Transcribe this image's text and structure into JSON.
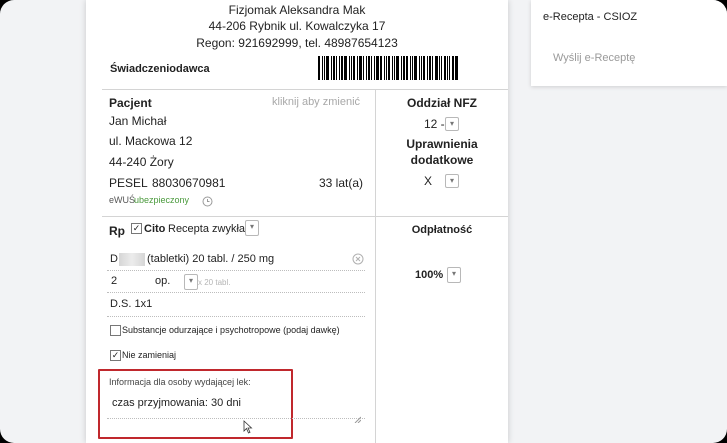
{
  "header": {
    "name": "Fizjomak Aleksandra Mak",
    "address": "44-206 Rybnik ul. Kowalczyka 17",
    "regon_line": "Regon: 921692999, tel. 48987654123",
    "provider_label": "Świadczeniodawca"
  },
  "patient": {
    "label": "Pacjent",
    "change_hint": "kliknij aby zmienić",
    "name": "Jan Michał",
    "street": "ul. Mackowa 12",
    "city": "44-240 Żory",
    "pesel_label": "PESEL",
    "pesel": "88030670981",
    "age": "33 lat(a)",
    "ewus_label": "eWUŚ",
    "ewus_status": "ubezpieczony",
    "ewus_icon": "clock-icon"
  },
  "nfz": {
    "label": "Oddział NFZ",
    "value": "12 -",
    "entitlements_label_1": "Uprawnienia",
    "entitlements_label_2": "dodatkowe",
    "entitlements_value": "X"
  },
  "prescription": {
    "rp_label": "Rp",
    "cito_label": "Cito",
    "cito_checked": true,
    "type": "Recepta zwykła",
    "drug_prefix": "D",
    "drug_suffix": "(tabletki) 20 tabl. / 250 mg",
    "quantity": "2",
    "unit": "op.",
    "package_hint": "x 20 tabl.",
    "dosage": "D.S. 1x1",
    "narcotics_label": "Substancje odurzające i psychotropowe (podaj dawkę)",
    "narcotics_checked": false,
    "no_substitute_label": "Nie zamieniaj",
    "no_substitute_checked": true,
    "pharmacist_info_label": "Informacja dla osoby wydającej lek:",
    "pharmacist_info_value": "czas przyjmowania: 30 dni"
  },
  "payment": {
    "label": "Odpłatność",
    "value": "100%"
  },
  "side_panel": {
    "title": "e-Recepta - CSIOZ",
    "send_button": "Wyślij e-Receptę"
  },
  "colors": {
    "ewus_green": "#4a9a3c",
    "highlight_red": "#c0282d",
    "muted_text": "#9a9a9a"
  }
}
